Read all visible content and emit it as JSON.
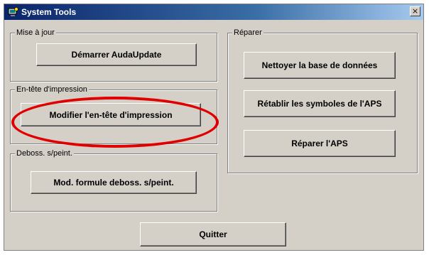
{
  "window": {
    "title": "System Tools",
    "close_label": "×",
    "icon": "computer-tools-icon"
  },
  "groups": {
    "mise_a_jour": {
      "label": "Mise à jour",
      "button": "Démarrer AudaUpdate"
    },
    "en_tete": {
      "label": "En-tête d'impression",
      "button": "Modifier l'en-tête d'impression"
    },
    "deboss": {
      "label": "Deboss. s/peint.",
      "button": "Mod. formule deboss. s/peint."
    },
    "reparer": {
      "label": "Réparer",
      "buttons": [
        "Nettoyer la base de données",
        "Rétablir les symboles de l'APS",
        "Réparer l'APS"
      ]
    }
  },
  "quit_button": "Quitter",
  "annotation": {
    "color": "#e00000",
    "shape": "ellipse"
  }
}
